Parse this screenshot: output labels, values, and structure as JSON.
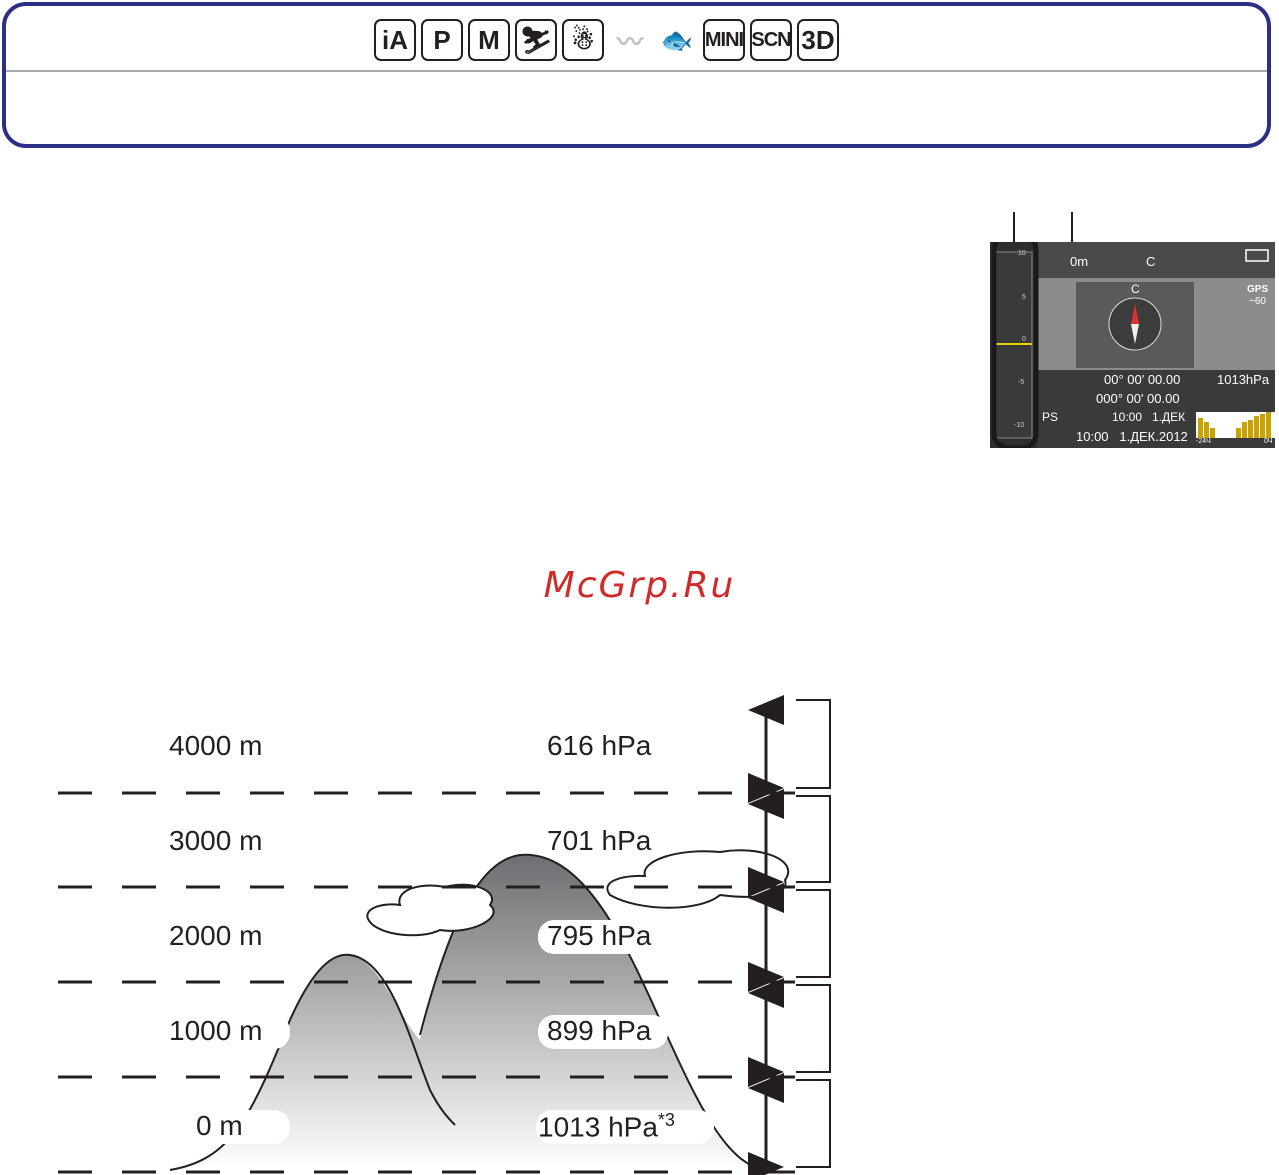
{
  "header": {
    "modes": [
      {
        "name": "ia-mode-icon",
        "label": "iA",
        "dim": false
      },
      {
        "name": "p-mode-icon",
        "label": "P",
        "dim": false
      },
      {
        "name": "m-mode-icon",
        "label": "M",
        "dim": false
      },
      {
        "name": "sports-mode-icon",
        "label": "⛷",
        "dim": false
      },
      {
        "name": "snow-mode-icon",
        "label": "☃",
        "dim": false
      },
      {
        "name": "beach-mode-icon",
        "label": "〰",
        "dim": true
      },
      {
        "name": "underwater-mode-icon",
        "label": "🐟",
        "dim": true
      },
      {
        "name": "miniature-mode-icon",
        "label": "MINI",
        "dim": false
      },
      {
        "name": "scn-mode-icon",
        "label": "SCN",
        "dim": false
      },
      {
        "name": "3d-mode-icon",
        "label": "3D",
        "dim": false
      }
    ]
  },
  "camera_screen": {
    "altitude": "0m",
    "compass_top": "C",
    "compass_dir": "C",
    "gps_label": "GPS",
    "gps_value": "~60",
    "latitude": "00° 00' 00.00",
    "longitude": "000° 00' 00.00",
    "pressure": "1013hPa",
    "gps_status": "PS",
    "gps_time": "10:00   1.ДЕК",
    "datetime": "10:00   1.ДЕК.2012",
    "hist_left": "-24Ч",
    "hist_right": "0Ч",
    "scale_ticks": [
      "10",
      "5",
      "0",
      "-5",
      "-10"
    ]
  },
  "watermark": "McGrp.Ru",
  "diagram": {
    "levels": [
      {
        "altitude": "4000 m",
        "pressure": "616 hPa"
      },
      {
        "altitude": "3000 m",
        "pressure": "701 hPa"
      },
      {
        "altitude": "2000 m",
        "pressure": "795 hPa"
      },
      {
        "altitude": "1000 m",
        "pressure": "899 hPa"
      },
      {
        "altitude": "0 m",
        "pressure": "1013 hPa"
      }
    ],
    "footnote_mark": "*3",
    "colors": {
      "line": "#231f20",
      "mountain_top": "#6d6e71",
      "mountain_bottom": "#ffffff"
    }
  }
}
